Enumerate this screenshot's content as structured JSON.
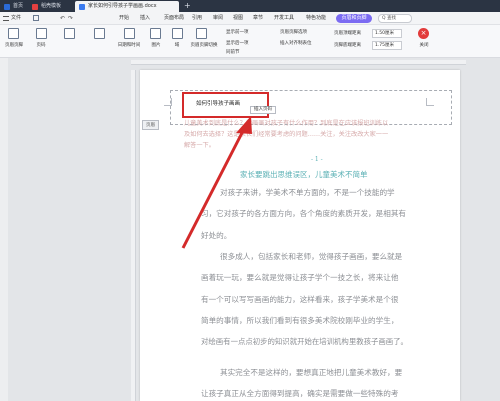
{
  "tabs": [
    {
      "label": "首页",
      "active": false,
      "color": "#2b6bd8"
    },
    {
      "label": "稻壳模板",
      "active": false,
      "color": "#e54040"
    },
    {
      "label": "家长如何引导孩子学画画.docx",
      "active": true,
      "color": "#3b7bf0"
    }
  ],
  "new_tab_label": "+",
  "menu": [
    "文件",
    "开始",
    "插入",
    "页面布局",
    "引用",
    "审阅",
    "视图",
    "章节",
    "开发工具",
    "特色功能"
  ],
  "highlight_tab": "页眉和页脚",
  "search_label": "Q 查找",
  "ribbon": {
    "header_footer_label": "页眉页脚",
    "page_label": "页码",
    "date_label": "日期和时间",
    "picture_label": "图片",
    "field_label": "域",
    "switch_label": "页眉页脚切换",
    "show_prev_label": "显示前一项",
    "show_next_label": "显示后一项",
    "same_as_prev_label": "同前节",
    "header_options_label": "页眉页脚选项",
    "insert_align_label": "插入对齐制表位",
    "header_top_label": "页眉顶端距离",
    "header_top_value": "1.50厘米",
    "footer_bottom_label": "页脚底端距离",
    "footer_bottom_value": "1.75厘米",
    "close_label": "关闭"
  },
  "header": {
    "text": "如何引导孩子画画",
    "tag": "页眉",
    "insert_page_label": "插入页码"
  },
  "document": {
    "faded_top_lines": [
      "儿童美术到底是什么？学画画对孩子有什么作用？到底是在应该报班训练以",
      "及如何去选择？这是家长们经常要考虑的问题……关注，关注改改大家一一",
      "解答一下。"
    ],
    "page_num": "- 1 -",
    "heading": "家长要跳出思维误区，儿童美术不简单",
    "paragraphs": [
      "对孩子来讲，学美术不单方面的，不是一个技能的学",
      "习，它对孩子的各方面方向，各个角度的素质开发，是相其有",
      "好处的。",
      "很多成人，包括家长和老师，觉得孩子画画，要么就是",
      "画着玩一玩，要么就是觉得让孩子学个一技之长，将来让他",
      "有一个可以写写画画的能力，这样看来，孩子学美术是个很",
      "简单的事情，所以我们看到有很多美术院校刚毕业的学生，",
      "对绘画有一点点初步的知识就开始在培训机构里教孩子画画了。",
      "其实完全不是这样的，要想真正地把儿童美术教好，要",
      "让孩子真正从全方面得到提高，确实是需要做一些特殊的考"
    ]
  },
  "colors": {
    "annotation_red": "#d42a2a",
    "heading_teal": "#5ab0b4"
  }
}
